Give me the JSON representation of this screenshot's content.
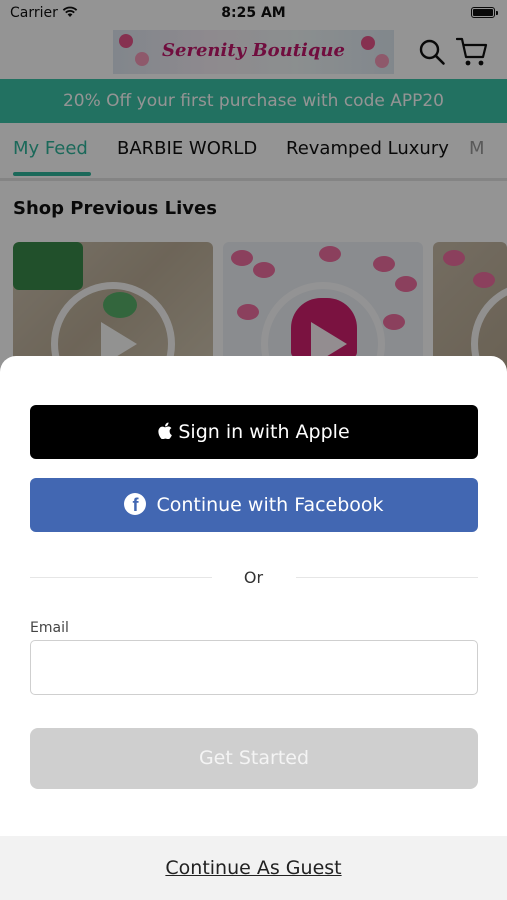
{
  "status_bar": {
    "carrier": "Carrier",
    "time": "8:25 AM"
  },
  "header": {
    "logo_text": "Serenity Boutique"
  },
  "promo": {
    "text": "20% Off your first purchase with code APP20",
    "color": "#3cc3a7"
  },
  "tabs": [
    {
      "label": "My Feed",
      "active": true
    },
    {
      "label": "BARBIE WORLD"
    },
    {
      "label": "Revamped Luxury"
    },
    {
      "label": "M"
    }
  ],
  "section": {
    "title": "Shop Previous Lives"
  },
  "colors": {
    "accent": "#2fb59b",
    "facebook": "#4267b2",
    "apple": "#000000"
  },
  "login": {
    "apple_label": "Sign in with Apple",
    "facebook_label": "Continue with Facebook",
    "or_label": "Or",
    "email_label": "Email",
    "email_value": "",
    "email_placeholder": "",
    "get_started_label": "Get Started",
    "guest_label": "Continue As Guest"
  },
  "icons": [
    "wifi-icon",
    "battery-icon",
    "search-icon",
    "cart-icon",
    "play-icon",
    "apple-icon",
    "facebook-icon"
  ]
}
